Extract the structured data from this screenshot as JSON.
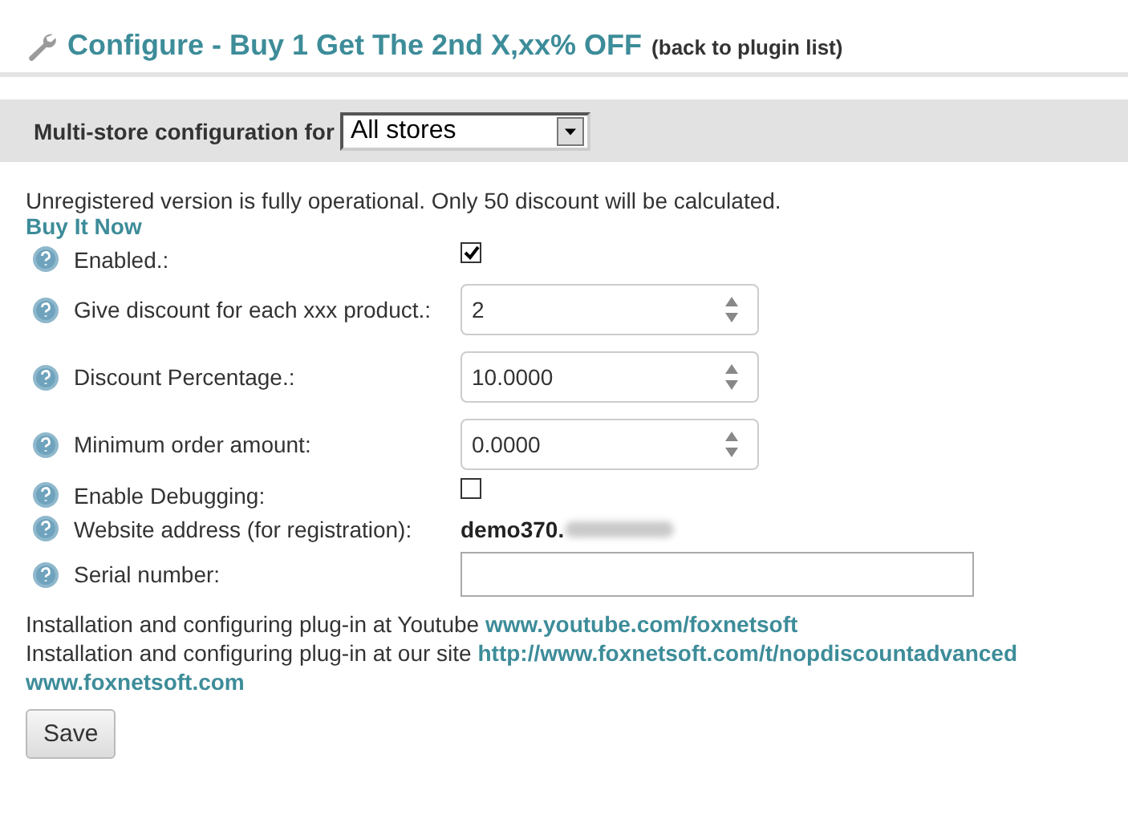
{
  "header": {
    "title": "Configure - Buy 1 Get The 2nd X,xx% OFF",
    "back_link": "(back to plugin list)"
  },
  "store_bar": {
    "label": "Multi-store configuration for",
    "value": "All stores"
  },
  "notice": {
    "text": "Unregistered version is fully operational. Only 50 discount will be calculated.",
    "link": "Buy It Now"
  },
  "fields": [
    {
      "kind": "checkbox",
      "label": "Enabled.:",
      "checked": true
    },
    {
      "kind": "number",
      "label": "Give discount for each xxx product.:",
      "value": "2"
    },
    {
      "kind": "number",
      "label": "Discount Percentage.:",
      "value": "10.0000"
    },
    {
      "kind": "number",
      "label": "Minimum order amount:",
      "value": "0.0000"
    },
    {
      "kind": "checkbox",
      "label": "Enable Debugging:",
      "checked": false
    },
    {
      "kind": "static",
      "label": "Website address (for registration):",
      "value": "demo370.",
      "redacted": true
    },
    {
      "kind": "text",
      "label": "Serial number:"
    }
  ],
  "info_lines": [
    {
      "text": "Installation and configuring plug-in at Youtube",
      "link": "www.youtube.com/foxnetsoft"
    },
    {
      "text": "Installation and configuring plug-in at our site",
      "link": "http://www.foxnetsoft.com/t/nopdiscountadvanced"
    },
    {
      "link": "www.foxnetsoft.com"
    }
  ],
  "save_button": "Save"
}
